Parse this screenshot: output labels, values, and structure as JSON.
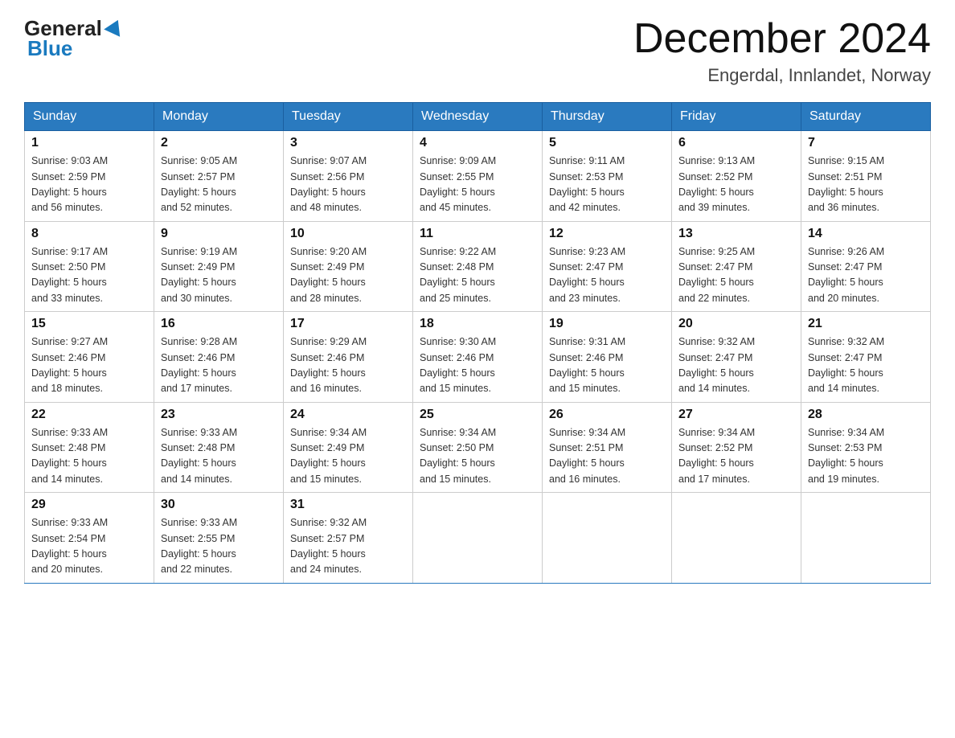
{
  "header": {
    "month_title": "December 2024",
    "location": "Engerdal, Innlandet, Norway",
    "logo_general": "General",
    "logo_blue": "Blue"
  },
  "days_of_week": [
    "Sunday",
    "Monday",
    "Tuesday",
    "Wednesday",
    "Thursday",
    "Friday",
    "Saturday"
  ],
  "weeks": [
    [
      {
        "day": "1",
        "sunrise": "9:03 AM",
        "sunset": "2:59 PM",
        "daylight": "5 hours and 56 minutes."
      },
      {
        "day": "2",
        "sunrise": "9:05 AM",
        "sunset": "2:57 PM",
        "daylight": "5 hours and 52 minutes."
      },
      {
        "day": "3",
        "sunrise": "9:07 AM",
        "sunset": "2:56 PM",
        "daylight": "5 hours and 48 minutes."
      },
      {
        "day": "4",
        "sunrise": "9:09 AM",
        "sunset": "2:55 PM",
        "daylight": "5 hours and 45 minutes."
      },
      {
        "day": "5",
        "sunrise": "9:11 AM",
        "sunset": "2:53 PM",
        "daylight": "5 hours and 42 minutes."
      },
      {
        "day": "6",
        "sunrise": "9:13 AM",
        "sunset": "2:52 PM",
        "daylight": "5 hours and 39 minutes."
      },
      {
        "day": "7",
        "sunrise": "9:15 AM",
        "sunset": "2:51 PM",
        "daylight": "5 hours and 36 minutes."
      }
    ],
    [
      {
        "day": "8",
        "sunrise": "9:17 AM",
        "sunset": "2:50 PM",
        "daylight": "5 hours and 33 minutes."
      },
      {
        "day": "9",
        "sunrise": "9:19 AM",
        "sunset": "2:49 PM",
        "daylight": "5 hours and 30 minutes."
      },
      {
        "day": "10",
        "sunrise": "9:20 AM",
        "sunset": "2:49 PM",
        "daylight": "5 hours and 28 minutes."
      },
      {
        "day": "11",
        "sunrise": "9:22 AM",
        "sunset": "2:48 PM",
        "daylight": "5 hours and 25 minutes."
      },
      {
        "day": "12",
        "sunrise": "9:23 AM",
        "sunset": "2:47 PM",
        "daylight": "5 hours and 23 minutes."
      },
      {
        "day": "13",
        "sunrise": "9:25 AM",
        "sunset": "2:47 PM",
        "daylight": "5 hours and 22 minutes."
      },
      {
        "day": "14",
        "sunrise": "9:26 AM",
        "sunset": "2:47 PM",
        "daylight": "5 hours and 20 minutes."
      }
    ],
    [
      {
        "day": "15",
        "sunrise": "9:27 AM",
        "sunset": "2:46 PM",
        "daylight": "5 hours and 18 minutes."
      },
      {
        "day": "16",
        "sunrise": "9:28 AM",
        "sunset": "2:46 PM",
        "daylight": "5 hours and 17 minutes."
      },
      {
        "day": "17",
        "sunrise": "9:29 AM",
        "sunset": "2:46 PM",
        "daylight": "5 hours and 16 minutes."
      },
      {
        "day": "18",
        "sunrise": "9:30 AM",
        "sunset": "2:46 PM",
        "daylight": "5 hours and 15 minutes."
      },
      {
        "day": "19",
        "sunrise": "9:31 AM",
        "sunset": "2:46 PM",
        "daylight": "5 hours and 15 minutes."
      },
      {
        "day": "20",
        "sunrise": "9:32 AM",
        "sunset": "2:47 PM",
        "daylight": "5 hours and 14 minutes."
      },
      {
        "day": "21",
        "sunrise": "9:32 AM",
        "sunset": "2:47 PM",
        "daylight": "5 hours and 14 minutes."
      }
    ],
    [
      {
        "day": "22",
        "sunrise": "9:33 AM",
        "sunset": "2:48 PM",
        "daylight": "5 hours and 14 minutes."
      },
      {
        "day": "23",
        "sunrise": "9:33 AM",
        "sunset": "2:48 PM",
        "daylight": "5 hours and 14 minutes."
      },
      {
        "day": "24",
        "sunrise": "9:34 AM",
        "sunset": "2:49 PM",
        "daylight": "5 hours and 15 minutes."
      },
      {
        "day": "25",
        "sunrise": "9:34 AM",
        "sunset": "2:50 PM",
        "daylight": "5 hours and 15 minutes."
      },
      {
        "day": "26",
        "sunrise": "9:34 AM",
        "sunset": "2:51 PM",
        "daylight": "5 hours and 16 minutes."
      },
      {
        "day": "27",
        "sunrise": "9:34 AM",
        "sunset": "2:52 PM",
        "daylight": "5 hours and 17 minutes."
      },
      {
        "day": "28",
        "sunrise": "9:34 AM",
        "sunset": "2:53 PM",
        "daylight": "5 hours and 19 minutes."
      }
    ],
    [
      {
        "day": "29",
        "sunrise": "9:33 AM",
        "sunset": "2:54 PM",
        "daylight": "5 hours and 20 minutes."
      },
      {
        "day": "30",
        "sunrise": "9:33 AM",
        "sunset": "2:55 PM",
        "daylight": "5 hours and 22 minutes."
      },
      {
        "day": "31",
        "sunrise": "9:32 AM",
        "sunset": "2:57 PM",
        "daylight": "5 hours and 24 minutes."
      },
      null,
      null,
      null,
      null
    ]
  ],
  "labels": {
    "sunrise": "Sunrise:",
    "sunset": "Sunset:",
    "daylight": "Daylight:"
  }
}
